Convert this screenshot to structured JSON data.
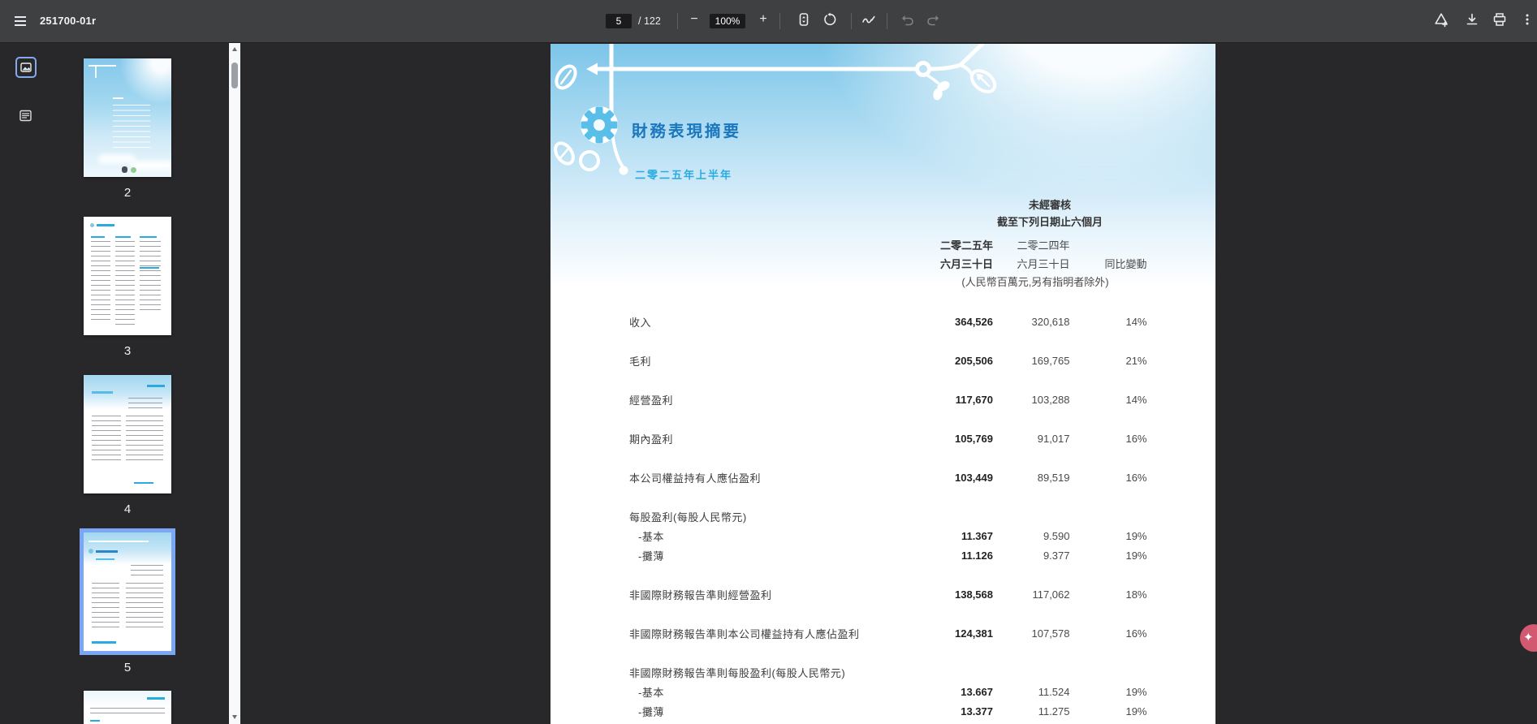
{
  "toolbar": {
    "title": "251700-01r",
    "page_input": "5",
    "page_total": "/ 122",
    "zoom_value": "100%",
    "zoom_out_glyph": "−",
    "zoom_in_glyph": "+"
  },
  "sidebar": {
    "pages": [
      {
        "label": "2"
      },
      {
        "label": "3"
      },
      {
        "label": "4"
      },
      {
        "label": "5",
        "selected": true
      },
      {
        "label": ""
      }
    ]
  },
  "document": {
    "title": "財務表現摘要",
    "subtitle": "二零二五年上半年",
    "table": {
      "unaudited": "未經審核",
      "period": "截至下列日期止六個月",
      "col_2025_year": "二零二五年",
      "col_2024_year": "二零二四年",
      "col_2025_date": "六月三十日",
      "col_2024_date": "六月三十日",
      "col_change": "同比變動",
      "unit_note": "(人民幣百萬元,另有指明者除外)",
      "rows": [
        {
          "label": "收入",
          "v2025": "364,526",
          "v2024": "320,618",
          "change": "14%"
        },
        {
          "label": "毛利",
          "v2025": "205,506",
          "v2024": "169,765",
          "change": "21%"
        },
        {
          "label": "經營盈利",
          "v2025": "117,670",
          "v2024": "103,288",
          "change": "14%"
        },
        {
          "label": "期內盈利",
          "v2025": "105,769",
          "v2024": "91,017",
          "change": "16%"
        },
        {
          "label": "本公司權益持有人應佔盈利",
          "v2025": "103,449",
          "v2024": "89,519",
          "change": "16%"
        },
        {
          "label": "每股盈利(每股人民幣元)"
        },
        {
          "label": "-基本",
          "v2025": "11.367",
          "v2024": "9.590",
          "change": "19%"
        },
        {
          "label": "-攤薄",
          "v2025": "11.126",
          "v2024": "9.377",
          "change": "19%"
        },
        {
          "label": "非國際財務報告準則經營盈利",
          "v2025": "138,568",
          "v2024": "117,062",
          "change": "18%"
        },
        {
          "label": "非國際財務報告準則本公司權益持有人應佔盈利",
          "v2025": "124,381",
          "v2024": "107,578",
          "change": "16%"
        },
        {
          "label": "非國際財務報告準則每股盈利(每股人民幣元)"
        },
        {
          "label": "-基本",
          "v2025": "13.667",
          "v2024": "11.524",
          "change": "19%"
        },
        {
          "label": "-攤薄",
          "v2025": "13.377",
          "v2024": "11.275",
          "change": "19%"
        }
      ]
    }
  },
  "floating_button": {
    "glyph": "✦"
  },
  "colors": {
    "accent_title_blue": "#1a76bd",
    "accent_light_blue": "#29aae1",
    "selection_blue": "#7aa6f3",
    "toolbar_bg": "#3f4042",
    "viewer_bg": "#28282a",
    "float_button_pink": "#d2596f"
  }
}
